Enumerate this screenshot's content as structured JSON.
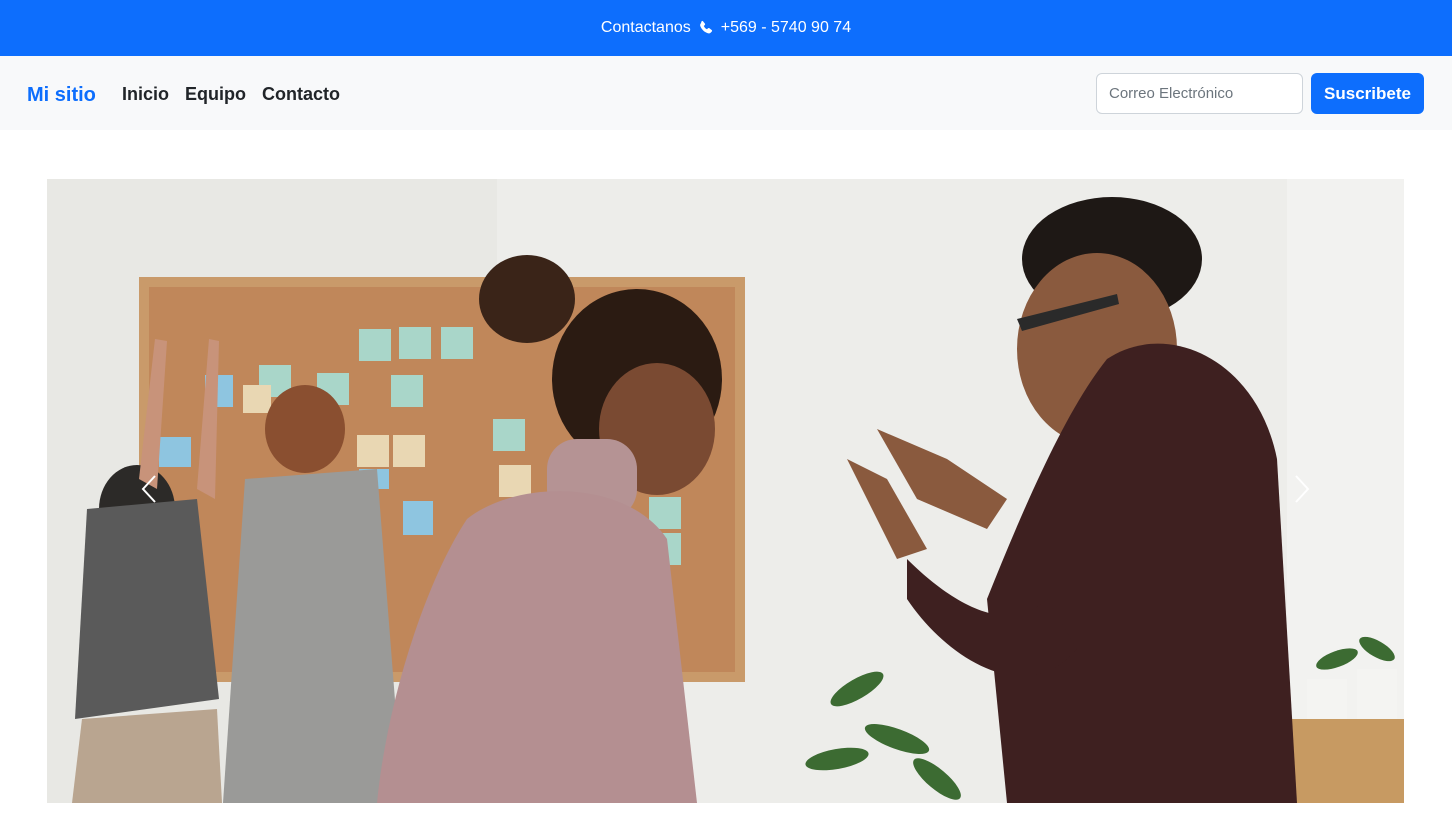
{
  "topbar": {
    "contact_label": "Contactanos",
    "phone_icon": "phone-icon",
    "phone_number": "+569 - 5740 90 74"
  },
  "navbar": {
    "brand": "Mi sitio",
    "links": [
      {
        "label": "Inicio"
      },
      {
        "label": "Equipo"
      },
      {
        "label": "Contacto"
      }
    ],
    "email_placeholder": "Correo Electrónico",
    "subscribe_label": "Suscribete"
  },
  "carousel": {
    "prev_icon": "chevron-left-icon",
    "next_icon": "chevron-right-icon"
  },
  "colors": {
    "primary": "#0d6efd",
    "navbar_bg": "#f8f9fa",
    "text_dark": "#212529"
  }
}
